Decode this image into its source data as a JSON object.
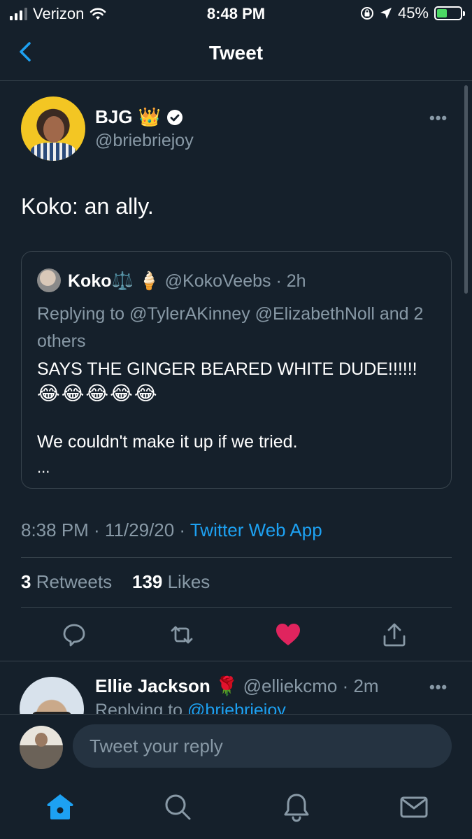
{
  "status_bar": {
    "carrier": "Verizon",
    "time": "8:48 PM",
    "battery_percent": "45%",
    "battery_level": 0.45,
    "icons": [
      "signal-icon",
      "wifi-icon",
      "orientation-lock-icon",
      "location-icon",
      "battery-charging-icon"
    ]
  },
  "header": {
    "title": "Tweet",
    "back_icon": "chevron-left-icon"
  },
  "tweet": {
    "author_name": "BJG",
    "author_emoji": "👑",
    "author_handle": "@briebriejoy",
    "more": "•••",
    "text": "Koko: an ally.",
    "timestamp": "8:38 PM · 11/29/20 · ",
    "source": "Twitter Web App",
    "retweets_count": "3",
    "retweets_label": " Retweets",
    "likes_count": "139",
    "likes_label": " Likes"
  },
  "quoted_tweet": {
    "name": "Koko",
    "name_emoji": "⚖️ 🍦",
    "handle_time": " @KokoVeebs · 2h",
    "replying": "Replying to @TylerAKinney @ElizabethNoll and 2 others",
    "body_line1": "SAYS THE GINGER BEARED WHITE DUDE!!!!!!",
    "emojis": "😂😂😂😂😂",
    "body_line2": "We couldn't make it up if we tried.",
    "ellipsis": "..."
  },
  "reply_preview": {
    "name": "Ellie Jackson",
    "name_emoji": "🌹",
    "handle_time": " @elliekcmo · 2m",
    "more": "•••",
    "replying_prefix": "Replying to ",
    "replying_mention": "@briebriejoy"
  },
  "compose": {
    "placeholder": "Tweet your reply"
  },
  "actions": [
    "reply-icon",
    "retweet-icon",
    "like-icon",
    "share-icon"
  ],
  "tabs": [
    "home-icon",
    "search-icon",
    "notifications-icon",
    "messages-icon"
  ],
  "colors": {
    "background": "#15202b",
    "accent": "#1da1f2",
    "secondary_text": "#8899a6",
    "like": "#e0245e",
    "divider": "#38444d"
  }
}
